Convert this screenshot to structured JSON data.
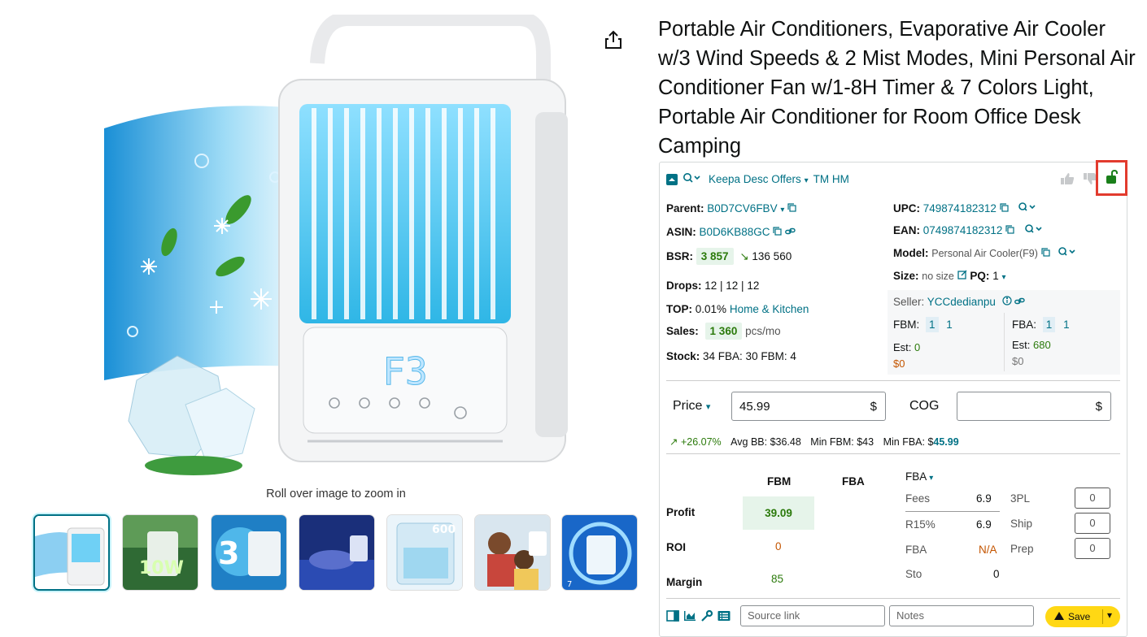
{
  "product": {
    "title": "Portable Air Conditioners, Evaporative Air Cooler w/3 Wind Speeds & 2 Mist Modes, Mini Personal Air Conditioner Fan w/1-8H Timer & 7 Colors Light, Portable Air Conditioner for Room Office Desk Camping",
    "zoom_hint": "Roll over image to zoom in",
    "thumbnails": [
      "thumb-1",
      "thumb-2",
      "thumb-3",
      "thumb-4",
      "thumb-5",
      "thumb-6",
      "thumb-7"
    ],
    "main_display_text": "F3"
  },
  "keepa": {
    "header": {
      "menu_label": "Keepa Desc Offers",
      "tm_label": "TM HM"
    },
    "left": {
      "parent_label": "Parent:",
      "parent_value": "B0D7CV6FBV",
      "asin_label": "ASIN:",
      "asin_value": "B0D6KB88GC",
      "bsr_label": "BSR:",
      "bsr_value": "3 857",
      "bsr_trend": "136 560",
      "drops_label": "Drops:",
      "drops_value": "12 | 12 | 12",
      "top_label": "TOP:",
      "top_value": "0.01%",
      "top_category": "Home & Kitchen",
      "sales_label": "Sales:",
      "sales_value": "1 360",
      "sales_unit": "pcs/mo",
      "stock_label": "Stock:",
      "stock_value": "34 FBA: 30 FBM: 4"
    },
    "right": {
      "upc_label": "UPC:",
      "upc_value": "749874182312",
      "ean_label": "EAN:",
      "ean_value": "0749874182312",
      "model_label": "Model:",
      "model_value": "Personal Air Cooler(F9)",
      "size_label": "Size:",
      "size_value": "no size",
      "pq_label": "PQ:",
      "pq_value": "1",
      "seller_label": "Seller:",
      "seller_value": "YCCdedianpu",
      "fbm_label": "FBM:",
      "fbm_count": "1",
      "fbm_count2": "1",
      "fbm_est_label": "Est:",
      "fbm_est_value": "0",
      "fbm_money": "$0",
      "fba_label": "FBA:",
      "fba_count": "1",
      "fba_count2": "1",
      "fba_est_label": "Est:",
      "fba_est_value": "680",
      "fba_money": "$0"
    },
    "pricing": {
      "price_label": "Price",
      "price_value": "45.99",
      "currency": "$",
      "cog_label": "COG",
      "cog_value": "",
      "trend_value": "+26.07%",
      "avg_bb": "Avg BB: $36.48",
      "min_fbm": "Min FBM: $43",
      "min_fba_label": "Min FBA: $",
      "min_fba_value": "45.99"
    },
    "profit": {
      "col_fbm": "FBM",
      "col_fba": "FBA",
      "fba_dropdown": "FBA",
      "profit_label": "Profit",
      "profit_fbm": "39.09",
      "roi_label": "ROI",
      "roi_fbm": "0",
      "margin_label": "Margin",
      "margin_fbm": "85",
      "fees_label": "Fees",
      "fees_value": "6.9",
      "r15_label": "R15%",
      "r15_value": "6.9",
      "fba_fee_label": "FBA",
      "fba_fee_value": "N/A",
      "sto_label": "Sto",
      "sto_value": "0",
      "threepl_label": "3PL",
      "threepl_value": "0",
      "ship_label": "Ship",
      "ship_value": "0",
      "prep_label": "Prep",
      "prep_value": "0"
    },
    "footer": {
      "source_placeholder": "Source link",
      "notes_placeholder": "Notes",
      "save_label": "Save"
    },
    "colors": {
      "accent": "#007185",
      "green": "#2b7a0b",
      "lock": "#1a7f1a",
      "highlight": "#e23b2e",
      "save": "#ffd814"
    }
  }
}
